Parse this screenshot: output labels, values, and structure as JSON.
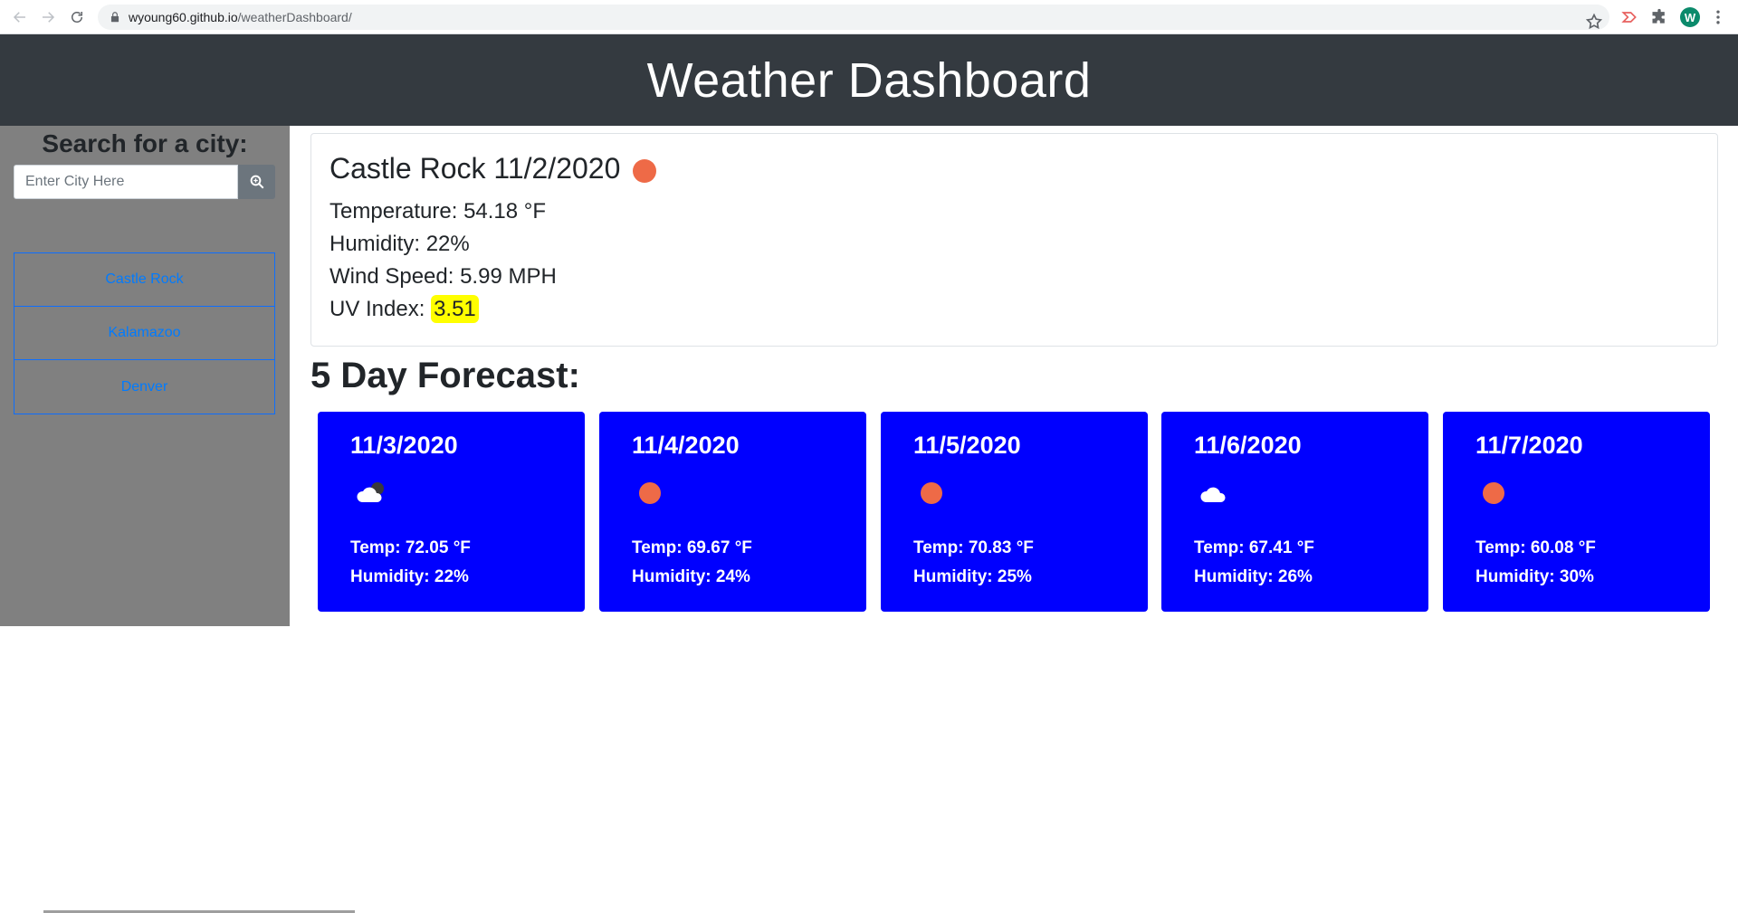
{
  "browser": {
    "url_host": "wyoung60.github.io",
    "url_path": "/weatherDashboard/",
    "profile_initial": "W"
  },
  "header": {
    "title": "Weather Dashboard"
  },
  "sidebar": {
    "heading": "Search for a city:",
    "search_placeholder": "Enter City Here",
    "search_icon": "search-icon",
    "history": [
      {
        "label": "Castle Rock"
      },
      {
        "label": "Kalamazoo"
      },
      {
        "label": "Denver"
      }
    ]
  },
  "current": {
    "title": "Castle Rock 11/2/2020",
    "icon": "sun-icon",
    "temperature": "Temperature: 54.18 °F",
    "humidity": "Humidity: 22%",
    "wind": "Wind Speed: 5.99 MPH",
    "uv_label": "UV Index: ",
    "uv_value": "3.51",
    "uv_color": "#ffff00"
  },
  "forecast": {
    "heading": "5 Day Forecast:",
    "card_color": "#0000ff",
    "days": [
      {
        "date": "11/3/2020",
        "icon": "cloud-night-icon",
        "temp": "Temp: 72.05 °F",
        "humidity": "Humidity: 22%"
      },
      {
        "date": "11/4/2020",
        "icon": "sun-icon",
        "temp": "Temp: 69.67 °F",
        "humidity": "Humidity: 24%"
      },
      {
        "date": "11/5/2020",
        "icon": "sun-icon",
        "temp": "Temp: 70.83 °F",
        "humidity": "Humidity: 25%"
      },
      {
        "date": "11/6/2020",
        "icon": "cloud-icon",
        "temp": "Temp: 67.41 °F",
        "humidity": "Humidity: 26%"
      },
      {
        "date": "11/7/2020",
        "icon": "sun-icon",
        "temp": "Temp: 60.08 °F",
        "humidity": "Humidity: 30%"
      }
    ]
  }
}
